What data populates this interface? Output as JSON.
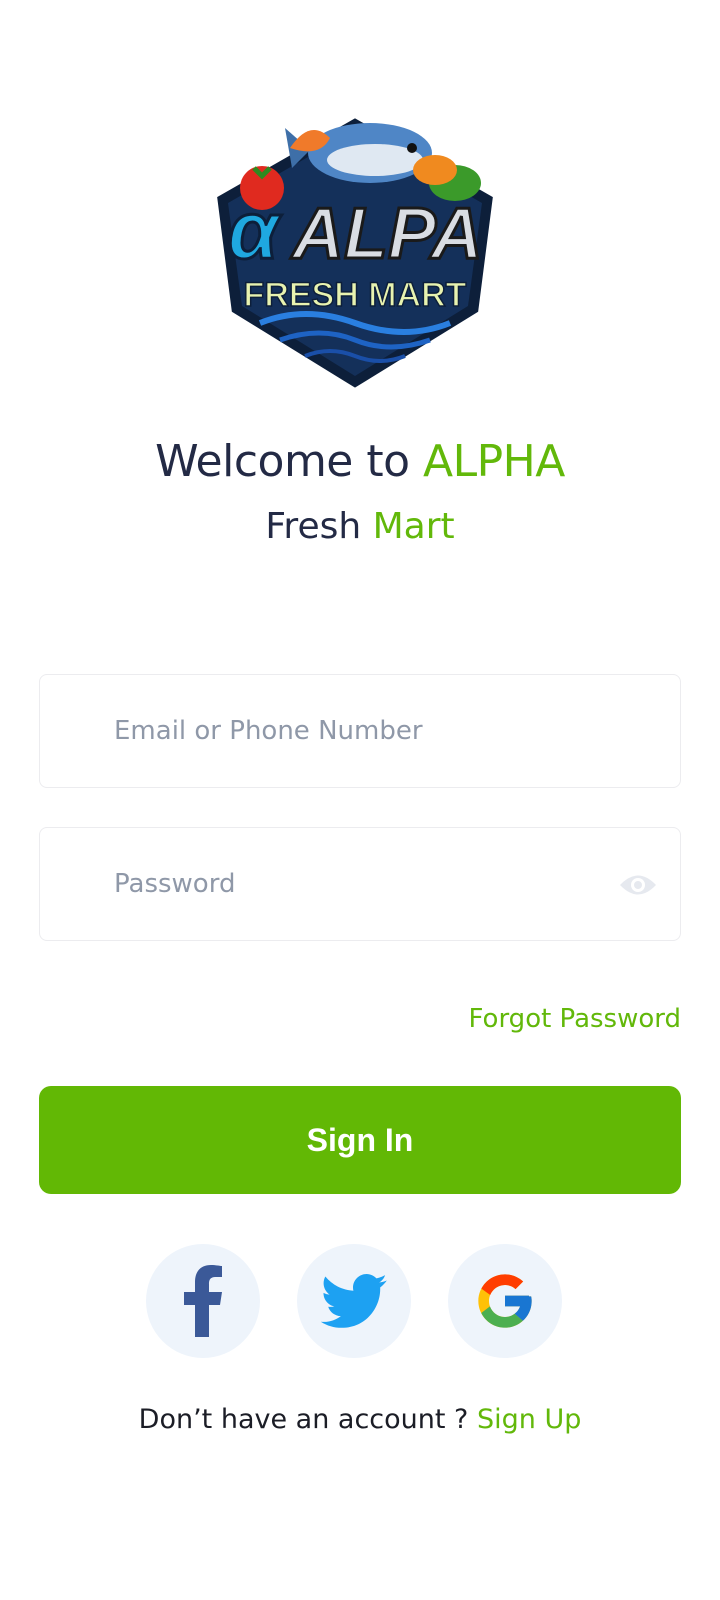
{
  "logo": {
    "brand_text": "ALPA",
    "tagline": "FRESH MART"
  },
  "welcome": {
    "prefix": "Welcome to ",
    "brand": "ALPHA",
    "sub_prefix": "Fresh ",
    "sub_brand": "Mart"
  },
  "form": {
    "email_placeholder": "Email or Phone Number",
    "email_value": "",
    "password_placeholder": "Password",
    "password_value": "",
    "forgot_label": "Forgot Password",
    "signin_label": "Sign In"
  },
  "social": [
    {
      "name": "facebook-icon"
    },
    {
      "name": "twitter-icon"
    },
    {
      "name": "google-icon"
    }
  ],
  "footer": {
    "prompt": "Don’t have an account ? ",
    "signup_label": "Sign Up"
  },
  "colors": {
    "accent": "#62b80a",
    "heading": "#232a45",
    "button": "#62b805",
    "social_bg": "#eef4fb"
  }
}
